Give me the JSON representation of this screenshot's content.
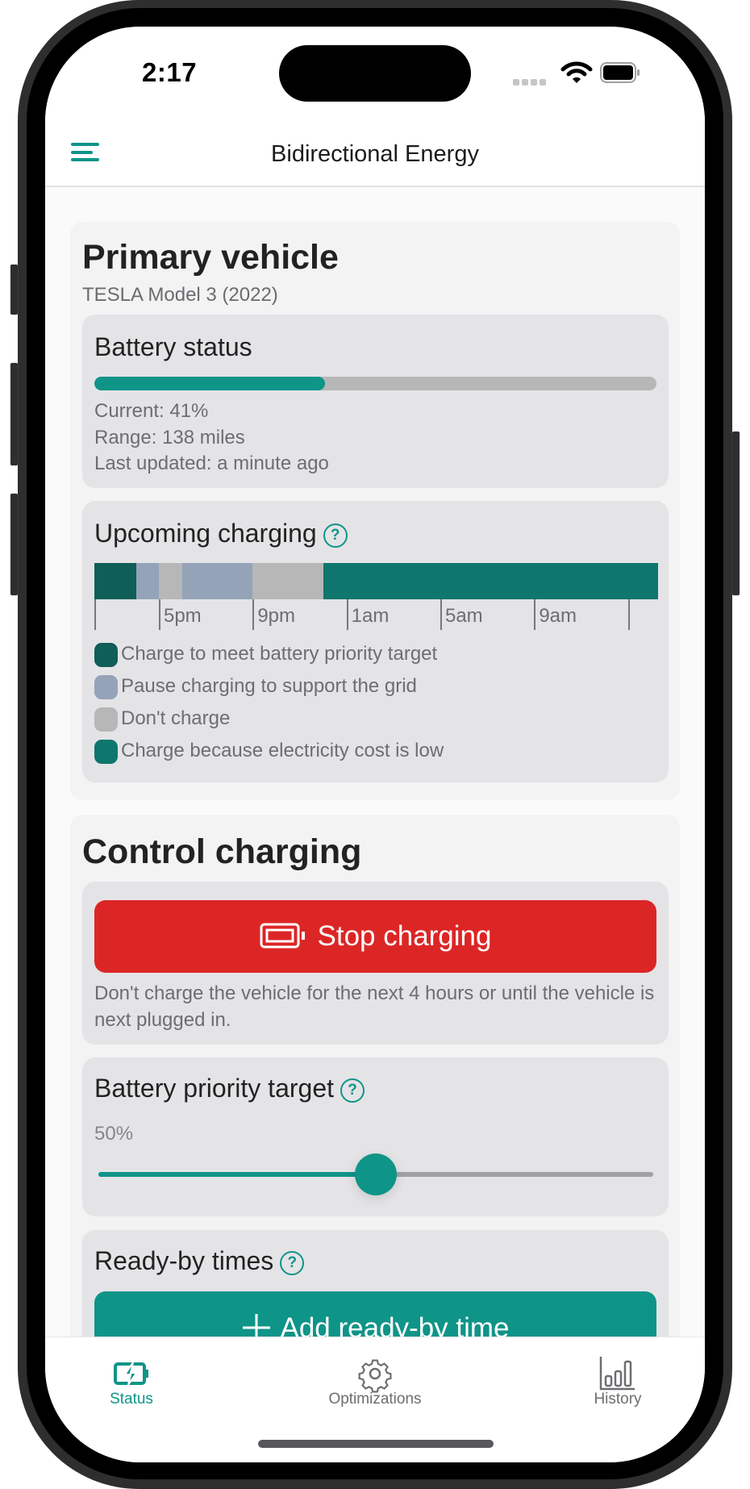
{
  "status_bar": {
    "time": "2:17"
  },
  "header": {
    "title": "Bidirectional Energy",
    "menu_icon": "hamburger-menu-icon"
  },
  "vehicle": {
    "title": "Primary vehicle",
    "model": "TESLA Model 3 (2022)",
    "battery_status": {
      "title": "Battery status",
      "charge_percent": 41,
      "current": "Current: 41%",
      "range": "Range: 138 miles",
      "last_updated": "Last updated: a minute ago"
    },
    "upcoming_charging": {
      "title": "Upcoming charging",
      "help_icon": "?",
      "timeline_hours": 24,
      "segments": [
        {
          "category": "target",
          "hours": 1.8
        },
        {
          "category": "pause",
          "hours": 0.95
        },
        {
          "category": "dont",
          "hours": 1.0
        },
        {
          "category": "pause",
          "hours": 3.0
        },
        {
          "category": "dont",
          "hours": 3.0
        },
        {
          "category": "low_cost",
          "hours": 14.25
        }
      ],
      "ticks": [
        {
          "offset_hours": 0,
          "label": ""
        },
        {
          "offset_hours": 2.75,
          "label": "5pm"
        },
        {
          "offset_hours": 6.75,
          "label": "9pm"
        },
        {
          "offset_hours": 10.75,
          "label": "1am"
        },
        {
          "offset_hours": 14.75,
          "label": "5am"
        },
        {
          "offset_hours": 18.75,
          "label": "9am"
        },
        {
          "offset_hours": 22.75,
          "label": ""
        }
      ],
      "legend": [
        {
          "key": "target",
          "label": "Charge to meet battery priority target",
          "color": "#0f5e57"
        },
        {
          "key": "pause",
          "label": "Pause charging to support the grid",
          "color": "#94a3b8"
        },
        {
          "key": "dont",
          "label": "Don't charge",
          "color": "#b7b7b7"
        },
        {
          "key": "low_cost",
          "label": "Charge because electricity cost is low",
          "color": "#0f766e"
        }
      ]
    }
  },
  "control": {
    "title": "Control charging",
    "stop_button": {
      "label": "Stop charging",
      "icon": "battery-icon"
    },
    "stop_description": "Don't charge the vehicle for the next 4 hours or until the vehicle is next plugged in.",
    "priority_target": {
      "title": "Battery priority target",
      "value_label": "50%",
      "value_percent": 50
    },
    "ready_by": {
      "title": "Ready-by times",
      "add_button": "Add ready-by time"
    }
  },
  "tabs": [
    {
      "label": "Status",
      "icon": "battery-charging-icon",
      "active": true
    },
    {
      "label": "Optimizations",
      "icon": "gear-icon",
      "active": false
    },
    {
      "label": "History",
      "icon": "bar-chart-icon",
      "active": false
    }
  ],
  "colors": {
    "accent": "#0f9488",
    "danger": "#dc2626",
    "inactive": "#6d6d72"
  }
}
